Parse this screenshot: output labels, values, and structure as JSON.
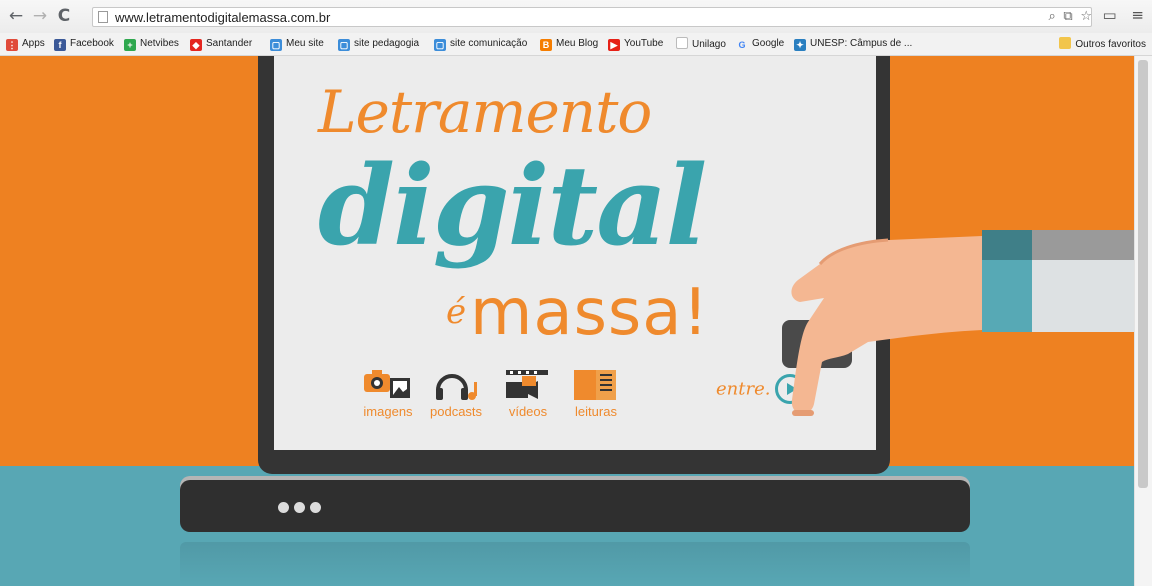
{
  "browser": {
    "url": "www.letramentodigitalemassa.com.br",
    "back_icon": "arrow-left-icon",
    "forward_icon": "arrow-right-icon",
    "reload_icon": "reload-icon"
  },
  "bookmarks": [
    {
      "label": "Apps",
      "icon": "apps-grid-icon",
      "color": "#e04b3a"
    },
    {
      "label": "Facebook",
      "icon": "facebook-icon",
      "color": "#3b5998"
    },
    {
      "label": "Netvibes",
      "icon": "netvibes-icon",
      "color": "#2fa84f"
    },
    {
      "label": "Santander",
      "icon": "santander-icon",
      "color": "#e4261f"
    },
    {
      "label": "Meu site",
      "icon": "site-icon",
      "color": "#3c8dd9"
    },
    {
      "label": "site pedagogia",
      "icon": "site-icon",
      "color": "#3c8dd9"
    },
    {
      "label": "site comunicação",
      "icon": "site-icon",
      "color": "#3c8dd9"
    },
    {
      "label": "Meu Blog",
      "icon": "blogger-icon",
      "color": "#f57d00"
    },
    {
      "label": "YouTube",
      "icon": "youtube-icon",
      "color": "#e62117"
    },
    {
      "label": "Unilago",
      "icon": "page-icon",
      "color": "#bbbbbb"
    },
    {
      "label": "Google",
      "icon": "google-icon",
      "color": "#4285f4"
    },
    {
      "label": "UNESP: Câmpus de ...",
      "icon": "unesp-icon",
      "color": "#2a7fc0"
    }
  ],
  "other_bookmarks": "Outros favoritos",
  "site": {
    "logo_line1": "Letramento",
    "logo_line2": "digital",
    "logo_e": "é",
    "logo_massa": "massa!",
    "menu": [
      {
        "label": "imagens",
        "icon": "camera-photo-icon"
      },
      {
        "label": "podcasts",
        "icon": "headphones-icon"
      },
      {
        "label": "vídeos",
        "icon": "video-camera-icon"
      },
      {
        "label": "leituras",
        "icon": "book-icon"
      }
    ],
    "enter_label": "entre.",
    "colors": {
      "orange": "#ee8121",
      "teal": "#3aa4ad",
      "screen": "#ececec",
      "monitor": "#343434"
    }
  }
}
